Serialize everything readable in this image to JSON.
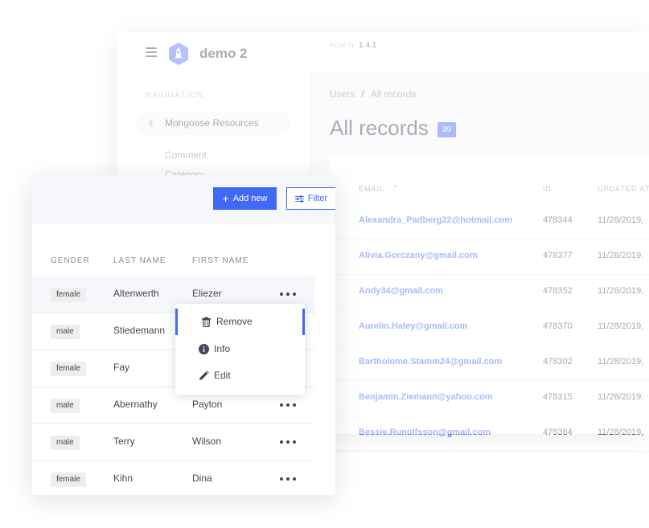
{
  "app": {
    "brand": "demo 2",
    "version_label": "ADMIN:",
    "version": "1.4.1"
  },
  "sidebar": {
    "heading": "NAVIGATION",
    "resource": "Mongoose Resources",
    "items": [
      "Comment",
      "Category"
    ]
  },
  "breadcrumb": {
    "root": "Users",
    "sep": "/",
    "current": "All records"
  },
  "records": {
    "title": "All records",
    "count": "99",
    "columns": {
      "email": "EMAIL",
      "id": "ID",
      "updated": "UPDATED AT"
    },
    "rows": [
      {
        "email": "Alexandra_Padberg22@hotmail.com",
        "id": "478344",
        "updated": "11/28/2019,"
      },
      {
        "email": "Alivia.Gorczany@gmail.com",
        "id": "478377",
        "updated": "11/28/2019,"
      },
      {
        "email": "Andy34@gmail.com",
        "id": "478352",
        "updated": "11/28/2019,"
      },
      {
        "email": "Aurelio.Haley@gmail.com",
        "id": "478370",
        "updated": "11/28/2019,"
      },
      {
        "email": "Bartholome.Stamm24@gmail.com",
        "id": "478302",
        "updated": "11/28/2019,"
      },
      {
        "email": "Benjamin.Ziemann@yahoo.com",
        "id": "478315",
        "updated": "11/28/2019,"
      },
      {
        "email": "Bessie.Runolfsson@gmail.com",
        "id": "478384",
        "updated": "11/28/2019,"
      }
    ]
  },
  "toolbar": {
    "add_new": "Add new",
    "filter": "Filter"
  },
  "table": {
    "columns": {
      "gender": "GENDER",
      "last_name": "LAST NAME",
      "first_name": "FIRST NAME"
    },
    "rows": [
      {
        "gender": "female",
        "last": "Altenwerth",
        "first": "Eliezer"
      },
      {
        "gender": "male",
        "last": "Stiedemann",
        "first": ""
      },
      {
        "gender": "female",
        "last": "Fay",
        "first": ""
      },
      {
        "gender": "male",
        "last": "Abernathy",
        "first": "Payton"
      },
      {
        "gender": "male",
        "last": "Terry",
        "first": "Wilson"
      },
      {
        "gender": "female",
        "last": "Kihn",
        "first": "Dina"
      }
    ]
  },
  "menu": {
    "remove": "Remove",
    "info": "Info",
    "edit": "Edit"
  },
  "colors": {
    "primary": "#4268f6",
    "text": "#454655",
    "muted": "#898a9a",
    "bg": "#f6f7fb"
  }
}
